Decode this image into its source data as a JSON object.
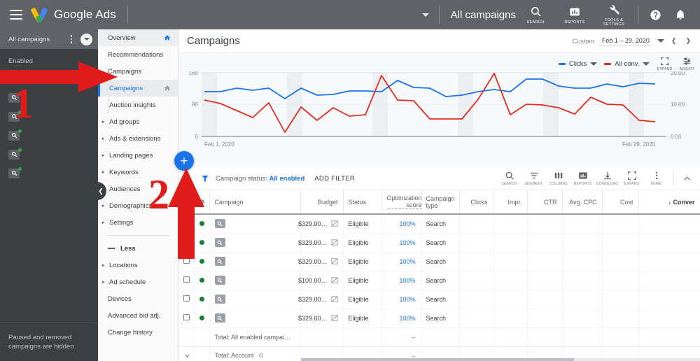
{
  "topbar": {
    "menu_icon": "hamburger-icon",
    "brand": "Google Ads",
    "account_title": "All campaigns",
    "icons": [
      {
        "name": "search-icon",
        "label": "SEARCH"
      },
      {
        "name": "reports-icon",
        "label": "REPORTS"
      },
      {
        "name": "tools-settings-icon",
        "label": "TOOLS &\nSETTINGS"
      }
    ],
    "help_icon": "help-icon",
    "notifications_icon": "bell-icon"
  },
  "account_panel": {
    "header_label": "All campaigns",
    "more_icon": "more-vertical-icon",
    "expand_icon": "chevron-down-circle-icon",
    "section_label": "Enabled",
    "items": [
      {
        "icon": "campaign-search-icon",
        "status": "enabled"
      },
      {
        "icon": "campaign-search-icon",
        "status": "enabled"
      },
      {
        "icon": "campaign-search-icon",
        "status": "enabled"
      },
      {
        "icon": "campaign-search-icon",
        "status": "enabled"
      },
      {
        "icon": "campaign-search-icon",
        "status": "enabled"
      },
      {
        "icon": "campaign-search-icon",
        "status": "enabled"
      }
    ],
    "footer_note": "Paused and removed campaigns are hidden",
    "collapse_icon": "chevron-left-icon"
  },
  "nav": {
    "items": [
      {
        "label": "Overview",
        "type": "head",
        "home": true
      },
      {
        "label": "Recommendations",
        "type": "plain"
      },
      {
        "label": "Campaigns",
        "type": "plain"
      },
      {
        "label": "Campaigns",
        "type": "active-sub",
        "home": true
      },
      {
        "label": "Auction insights",
        "type": "sub"
      },
      {
        "label": "Ad groups",
        "type": "expand"
      },
      {
        "label": "Ads & extensions",
        "type": "expand"
      },
      {
        "label": "Landing pages",
        "type": "expand"
      },
      {
        "label": "Keywords",
        "type": "expand"
      },
      {
        "label": "Audiences",
        "type": "expand"
      },
      {
        "label": "Demographics",
        "type": "expand"
      },
      {
        "label": "Settings",
        "type": "expand"
      }
    ],
    "less_label": "Less",
    "items2": [
      {
        "label": "Locations",
        "type": "expand"
      },
      {
        "label": "Ad schedule",
        "type": "expand"
      },
      {
        "label": "Devices",
        "type": "plain"
      },
      {
        "label": "Advanced bid adj.",
        "type": "plain"
      },
      {
        "label": "Change history",
        "type": "plain"
      }
    ]
  },
  "page": {
    "title": "Campaigns",
    "date_label": "Custom",
    "date_value": "Feb 1 – 29, 2020",
    "date_dropdown_icon": "chevron-down-icon",
    "prev_icon": "chevron-left-icon",
    "next_icon": "chevron-right-icon"
  },
  "chart_controls": {
    "legend": [
      {
        "label": "Clicks",
        "color": "#1a73e8",
        "dropdown_icon": "chevron-down-icon"
      },
      {
        "label": "All conv.",
        "color": "#d93025",
        "dropdown_icon": "chevron-down-icon"
      }
    ],
    "tools": [
      {
        "name": "expand-icon",
        "label": "EXPAND"
      },
      {
        "name": "adjust-icon",
        "label": "ADJUST"
      }
    ]
  },
  "chart_data": {
    "type": "line",
    "title": "",
    "xlabel": "",
    "ylabel": "",
    "grid": true,
    "legend_position": "top-right",
    "x_tick_labels": [
      "Feb 1, 2020",
      "Feb 29, 2020"
    ],
    "left_axis": {
      "label": "Clicks",
      "ticks": [
        0,
        80,
        160
      ],
      "range": [
        0,
        160
      ]
    },
    "right_axis": {
      "label": "All conv.",
      "ticks": [
        "0.00",
        "10.00",
        "20.00"
      ],
      "range": [
        0,
        20
      ]
    },
    "x": [
      "Feb 1",
      "Feb 2",
      "Feb 3",
      "Feb 4",
      "Feb 5",
      "Feb 6",
      "Feb 7",
      "Feb 8",
      "Feb 9",
      "Feb 10",
      "Feb 11",
      "Feb 12",
      "Feb 13",
      "Feb 14",
      "Feb 15",
      "Feb 16",
      "Feb 17",
      "Feb 18",
      "Feb 19",
      "Feb 20",
      "Feb 21",
      "Feb 22",
      "Feb 23",
      "Feb 24",
      "Feb 25",
      "Feb 26",
      "Feb 27",
      "Feb 28",
      "Feb 29"
    ],
    "series": [
      {
        "name": "Clicks",
        "color": "#1a73e8",
        "axis": "left",
        "values": [
          112,
          111,
          121,
          116,
          121,
          95,
          121,
          104,
          106,
          113,
          113,
          111,
          141,
          122,
          120,
          101,
          104,
          112,
          118,
          112,
          143,
          143,
          125,
          120,
          120,
          130,
          123,
          133,
          131
        ]
      },
      {
        "name": "All conv.",
        "color": "#d93025",
        "axis": "right",
        "values": [
          11.2,
          10.2,
          8.1,
          5.9,
          10.3,
          1.2,
          9.0,
          4.9,
          8.9,
          6.3,
          6.7,
          18.6,
          11.2,
          11.0,
          5.3,
          5.3,
          5.3,
          11.3,
          19.0,
          6.7,
          9.8,
          9.6,
          8.9,
          6.8,
          12.0,
          9.9,
          9.6,
          5.1,
          4.6
        ]
      }
    ]
  },
  "filterbar": {
    "funnel_icon": "filter-icon",
    "chip_prefix": "Campaign status: ",
    "chip_value": "All enabled",
    "add_filter": "ADD FILTER",
    "tools": [
      {
        "name": "search-icon",
        "label": "SEARCH"
      },
      {
        "name": "segment-icon",
        "label": "SEGMENT"
      },
      {
        "name": "columns-icon",
        "label": "COLUMNS"
      },
      {
        "name": "reports-icon",
        "label": "REPORTS"
      },
      {
        "name": "download-icon",
        "label": "DOWNLOAD"
      },
      {
        "name": "expand-icon",
        "label": "EXPAND"
      },
      {
        "name": "more-icon",
        "label": "MORE"
      }
    ],
    "collapse_icon": "chevron-up-icon"
  },
  "fab": {
    "label": "+",
    "icon": "plus-icon"
  },
  "table": {
    "headers": [
      {
        "label": "",
        "key": "checkbox",
        "align": "left"
      },
      {
        "label": "",
        "key": "statusdot",
        "align": "left"
      },
      {
        "label": "Campaign",
        "key": "campaign",
        "align": "left"
      },
      {
        "label": "Budget",
        "key": "budget",
        "align": "right"
      },
      {
        "label": "Status",
        "key": "status",
        "align": "left"
      },
      {
        "label": "Optimization score",
        "key": "optscore",
        "align": "right",
        "dotted": true
      },
      {
        "label": "Campaign type",
        "key": "camptype",
        "align": "left"
      },
      {
        "label": "Clicks",
        "key": "clicks",
        "align": "right"
      },
      {
        "label": "Impr.",
        "key": "impr",
        "align": "right"
      },
      {
        "label": "CTR",
        "key": "ctr",
        "align": "right"
      },
      {
        "label": "Avg. CPC",
        "key": "cpc",
        "align": "right"
      },
      {
        "label": "Cost",
        "key": "cost",
        "align": "right"
      },
      {
        "label": "Conver",
        "key": "conver",
        "align": "right",
        "sorted": true,
        "sort_icon": "sort-desc-icon"
      }
    ],
    "rows": [
      {
        "checkbox": false,
        "checkbox_hidden": true,
        "status_dot": "#188038",
        "campaign_icon": "campaign-search-icon",
        "budget": "$329.00…",
        "budget_icon": "budget-shared-icon",
        "status": "Eligible",
        "optscore": "100%",
        "camptype": "Search",
        "clicks": "",
        "impr": "",
        "ctr": "",
        "cpc": "",
        "cost": "",
        "conver": ""
      },
      {
        "checkbox": false,
        "checkbox_hidden": true,
        "status_dot": "#188038",
        "campaign_icon": "campaign-search-icon",
        "budget": "$329.00…",
        "budget_icon": "budget-shared-icon",
        "status": "Eligible",
        "optscore": "100%",
        "camptype": "Search",
        "clicks": "",
        "impr": "",
        "ctr": "",
        "cpc": "",
        "cost": "",
        "conver": ""
      },
      {
        "checkbox": false,
        "checkbox_hidden": false,
        "status_dot": "#188038",
        "campaign_icon": "campaign-search-icon",
        "budget": "$329.00…",
        "budget_icon": "budget-shared-icon",
        "status": "Eligible",
        "optscore": "100%",
        "camptype": "Search",
        "clicks": "",
        "impr": "",
        "ctr": "",
        "cpc": "",
        "cost": "",
        "conver": ""
      },
      {
        "checkbox": false,
        "checkbox_hidden": false,
        "status_dot": "#188038",
        "campaign_icon": "campaign-search-icon",
        "budget": "$100.00…",
        "budget_icon": "budget-shared-icon",
        "status": "Eligible",
        "optscore": "100%",
        "camptype": "Search",
        "clicks": "",
        "impr": "",
        "ctr": "",
        "cpc": "",
        "cost": "",
        "conver": ""
      },
      {
        "checkbox": false,
        "checkbox_hidden": false,
        "status_dot": "#188038",
        "campaign_icon": "campaign-search-icon",
        "budget": "$329.00…",
        "budget_icon": "budget-shared-icon",
        "status": "Eligible",
        "optscore": "100%",
        "camptype": "Search",
        "clicks": "",
        "impr": "",
        "ctr": "",
        "cpc": "",
        "cost": "",
        "conver": ""
      },
      {
        "checkbox": false,
        "checkbox_hidden": false,
        "status_dot": "#188038",
        "campaign_icon": "campaign-search-icon",
        "budget": "$329.00…",
        "budget_icon": "budget-shared-icon",
        "status": "Eligible",
        "optscore": "100%",
        "camptype": "Search",
        "clicks": "",
        "impr": "",
        "ctr": "",
        "cpc": "",
        "cost": "",
        "conver": ""
      }
    ],
    "totals": [
      {
        "label": "Total: All enabled campai…",
        "optscore": "–",
        "expander": false
      },
      {
        "label": "Total: Account",
        "optscore": "–",
        "expander": true,
        "help_icon": "help-circle-icon"
      }
    ]
  },
  "annotations": [
    {
      "name": "step-1-arrow",
      "text": "1",
      "color": "#e01b1b"
    },
    {
      "name": "step-2-arrow",
      "text": "2",
      "color": "#e01b1b"
    }
  ]
}
